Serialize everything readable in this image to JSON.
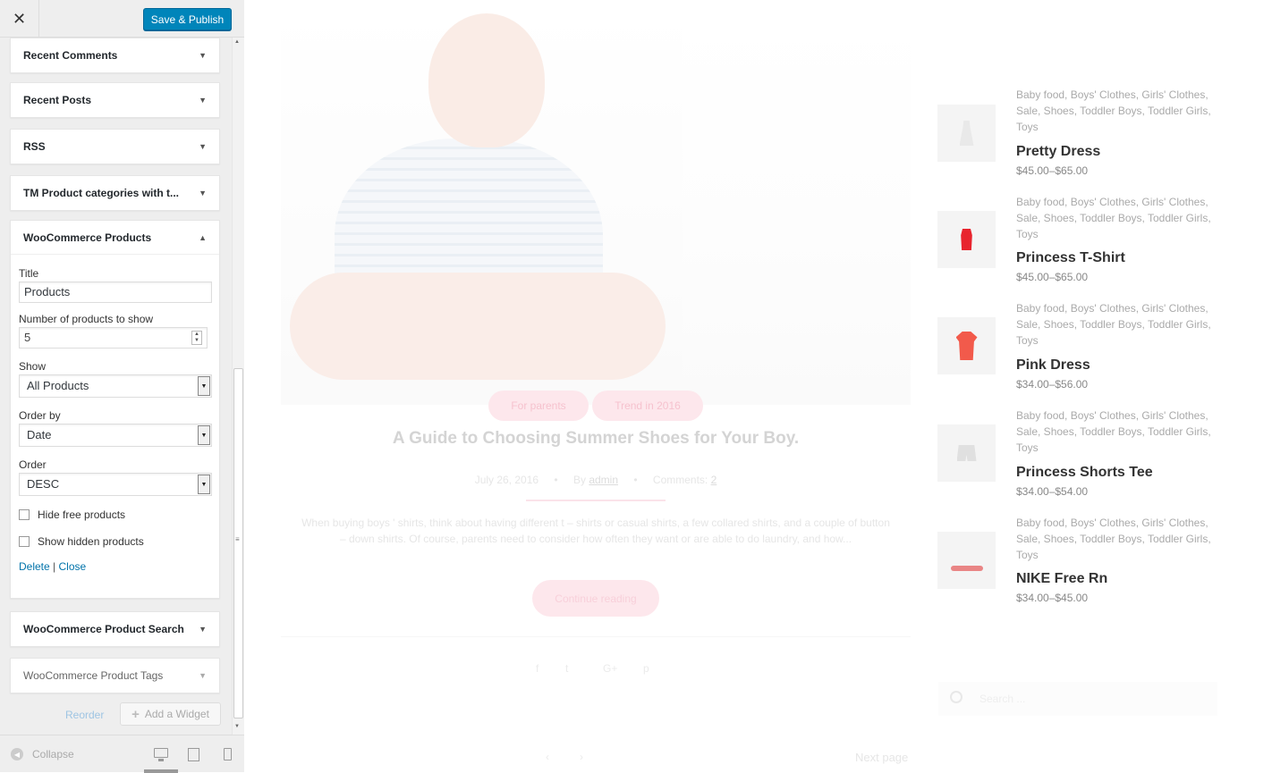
{
  "header": {
    "close_icon": "close-icon",
    "publish_label": "Save & Publish"
  },
  "widgets": [
    {
      "label": "Recent Comments"
    },
    {
      "label": "Recent Posts"
    },
    {
      "label": "RSS"
    },
    {
      "label": "TM Product categories with t..."
    },
    {
      "label": "WooCommerce Products"
    },
    {
      "label": "WooCommerce Product Search"
    },
    {
      "label": "WooCommerce Product Tags"
    }
  ],
  "form": {
    "title_label": "Title",
    "title_value": "Products",
    "count_label": "Number of products to show",
    "count_value": "5",
    "show_label": "Show",
    "show_value": "All Products",
    "orderby_label": "Order by",
    "orderby_value": "Date",
    "order_label": "Order",
    "order_value": "DESC",
    "hide_free_label": "Hide free products",
    "show_hidden_label": "Show hidden products",
    "delete_label": "Delete",
    "separator": "|",
    "close_label": "Close"
  },
  "panel_actions": {
    "reorder_label": "Reorder",
    "add_widget_label": "Add a Widget"
  },
  "footer": {
    "collapse_label": "Collapse"
  },
  "post": {
    "tags": [
      "For parents",
      "Trend in 2016"
    ],
    "title": "A Guide to Choosing Summer Shoes for Your Boy.",
    "date": "July 26, 2016",
    "by": "By",
    "author": "admin",
    "comments_label": "Comments:",
    "comments_count": "2",
    "excerpt": "When buying boys ' shirts, think about having different t – shirts or casual shirts, a few collared shirts, and a couple of button – down shirts. Of course, parents need to consider how often they want or are able to do laundry, and how...",
    "continue_label": "Continue reading",
    "next_page_label": "Next page"
  },
  "search": {
    "placeholder": "Search ..."
  },
  "products": [
    {
      "cats": "Baby food, Boys' Clothes, Girls' Clothes, Sale, Shoes, Toddler Boys, Toddler Girls, Toys",
      "name": "Pretty Dress",
      "price": "$45.00–$65.00"
    },
    {
      "cats": "Baby food, Boys' Clothes, Girls' Clothes, Sale, Shoes, Toddler Boys, Toddler Girls, Toys",
      "name": "Princess T-Shirt",
      "price": "$45.00–$65.00"
    },
    {
      "cats": "Baby food, Boys' Clothes, Girls' Clothes, Sale, Shoes, Toddler Boys, Toddler Girls, Toys",
      "name": "Pink Dress",
      "price": "$34.00–$56.00"
    },
    {
      "cats": "Baby food, Boys' Clothes, Girls' Clothes, Sale, Shoes, Toddler Boys, Toddler Girls, Toys",
      "name": "Princess Shorts Tee",
      "price": "$34.00–$54.00"
    },
    {
      "cats": "Baby food, Boys' Clothes, Girls' Clothes, Sale, Shoes, Toddler Boys, Toddler Girls, Toys",
      "name": "NIKE Free Rn",
      "price": "$34.00–$45.00"
    }
  ],
  "colors": {
    "accent": "#0085ba",
    "link": "#0073aa",
    "pink": "#fde7ec"
  }
}
